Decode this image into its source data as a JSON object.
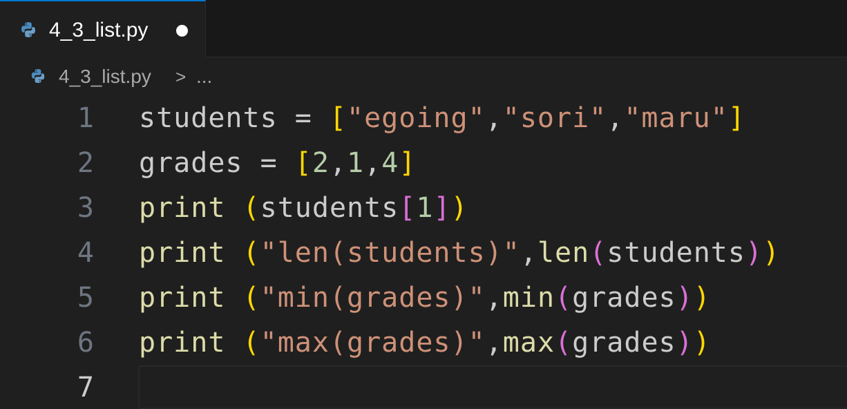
{
  "tab": {
    "filename": "4_3_list.py",
    "modified": true
  },
  "breadcrumb": {
    "file": "4_3_list.py",
    "separator": ">",
    "more": "..."
  },
  "icons": {
    "file_type": "python-icon",
    "dirty_indicator": "dot-icon",
    "separator": "chevron-right-icon"
  },
  "colors": {
    "tab_active_border": "#0078d4",
    "string": "#ce9178",
    "number": "#b5cea8",
    "function": "#dcdcaa",
    "bracket_level_1": "#ffd700",
    "bracket_level_2": "#da70d6",
    "identifier": "#cccccc"
  },
  "editor": {
    "current_line": 7,
    "lines": [
      {
        "number": "1",
        "tokens": [
          {
            "t": "var",
            "v": "students"
          },
          {
            "t": "op",
            "v": " = "
          },
          {
            "t": "b1",
            "v": "["
          },
          {
            "t": "str",
            "v": "\"egoing\""
          },
          {
            "t": "op",
            "v": ","
          },
          {
            "t": "str",
            "v": "\"sori\""
          },
          {
            "t": "op",
            "v": ","
          },
          {
            "t": "str",
            "v": "\"maru\""
          },
          {
            "t": "b1",
            "v": "]"
          }
        ]
      },
      {
        "number": "2",
        "tokens": [
          {
            "t": "var",
            "v": "grades"
          },
          {
            "t": "op",
            "v": " = "
          },
          {
            "t": "b1",
            "v": "["
          },
          {
            "t": "num",
            "v": "2"
          },
          {
            "t": "op",
            "v": ","
          },
          {
            "t": "num",
            "v": "1"
          },
          {
            "t": "op",
            "v": ","
          },
          {
            "t": "num",
            "v": "4"
          },
          {
            "t": "b1",
            "v": "]"
          }
        ]
      },
      {
        "number": "3",
        "tokens": [
          {
            "t": "fn",
            "v": "print"
          },
          {
            "t": "op",
            "v": " "
          },
          {
            "t": "b1",
            "v": "("
          },
          {
            "t": "var",
            "v": "students"
          },
          {
            "t": "b2",
            "v": "["
          },
          {
            "t": "num",
            "v": "1"
          },
          {
            "t": "b2",
            "v": "]"
          },
          {
            "t": "b1",
            "v": ")"
          }
        ]
      },
      {
        "number": "4",
        "tokens": [
          {
            "t": "fn",
            "v": "print"
          },
          {
            "t": "op",
            "v": " "
          },
          {
            "t": "b1",
            "v": "("
          },
          {
            "t": "str",
            "v": "\"len(students)\""
          },
          {
            "t": "op",
            "v": ","
          },
          {
            "t": "fn",
            "v": "len"
          },
          {
            "t": "b2",
            "v": "("
          },
          {
            "t": "var",
            "v": "students"
          },
          {
            "t": "b2",
            "v": ")"
          },
          {
            "t": "b1",
            "v": ")"
          }
        ]
      },
      {
        "number": "5",
        "tokens": [
          {
            "t": "fn",
            "v": "print"
          },
          {
            "t": "op",
            "v": " "
          },
          {
            "t": "b1",
            "v": "("
          },
          {
            "t": "str",
            "v": "\"min(grades)\""
          },
          {
            "t": "op",
            "v": ","
          },
          {
            "t": "fn",
            "v": "min"
          },
          {
            "t": "b2",
            "v": "("
          },
          {
            "t": "var",
            "v": "grades"
          },
          {
            "t": "b2",
            "v": ")"
          },
          {
            "t": "b1",
            "v": ")"
          }
        ]
      },
      {
        "number": "6",
        "tokens": [
          {
            "t": "fn",
            "v": "print"
          },
          {
            "t": "op",
            "v": " "
          },
          {
            "t": "b1",
            "v": "("
          },
          {
            "t": "str",
            "v": "\"max(grades)\""
          },
          {
            "t": "op",
            "v": ","
          },
          {
            "t": "fn",
            "v": "max"
          },
          {
            "t": "b2",
            "v": "("
          },
          {
            "t": "var",
            "v": "grades"
          },
          {
            "t": "b2",
            "v": ")"
          },
          {
            "t": "b1",
            "v": ")"
          }
        ]
      },
      {
        "number": "7",
        "tokens": []
      }
    ]
  }
}
